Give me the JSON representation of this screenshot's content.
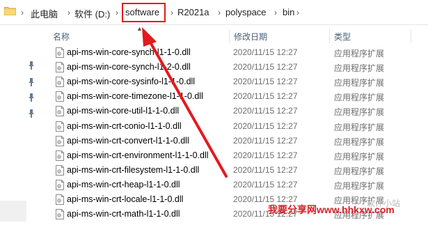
{
  "address_bar": {
    "segments": [
      "此电脑",
      "软件 (D:)",
      "software",
      "R2021a",
      "polyspace",
      "bin"
    ]
  },
  "columns": {
    "name": "名称",
    "date": "修改日期",
    "type": "类型"
  },
  "files": [
    {
      "name": "api-ms-win-core-synch-l1-1-0.dll",
      "date": "2020/11/15 12:27",
      "type": "应用程序扩展"
    },
    {
      "name": "api-ms-win-core-synch-l1-2-0.dll",
      "date": "2020/11/15 12:27",
      "type": "应用程序扩展"
    },
    {
      "name": "api-ms-win-core-sysinfo-l1-1-0.dll",
      "date": "2020/11/15 12:27",
      "type": "应用程序扩展"
    },
    {
      "name": "api-ms-win-core-timezone-l1-1-0.dll",
      "date": "2020/11/15 12:27",
      "type": "应用程序扩展"
    },
    {
      "name": "api-ms-win-core-util-l1-1-0.dll",
      "date": "2020/11/15 12:27",
      "type": "应用程序扩展"
    },
    {
      "name": "api-ms-win-crt-conio-l1-1-0.dll",
      "date": "2020/11/15 12:27",
      "type": "应用程序扩展"
    },
    {
      "name": "api-ms-win-crt-convert-l1-1-0.dll",
      "date": "2020/11/15 12:27",
      "type": "应用程序扩展"
    },
    {
      "name": "api-ms-win-crt-environment-l1-1-0.dll",
      "date": "2020/11/15 12:27",
      "type": "应用程序扩展"
    },
    {
      "name": "api-ms-win-crt-filesystem-l1-1-0.dll",
      "date": "2020/11/15 12:27",
      "type": "应用程序扩展"
    },
    {
      "name": "api-ms-win-crt-heap-l1-1-0.dll",
      "date": "2020/11/15 12:27",
      "type": "应用程序扩展"
    },
    {
      "name": "api-ms-win-crt-locale-l1-1-0.dll",
      "date": "2020/11/15 12:27",
      "type": "应用程序扩展"
    },
    {
      "name": "api-ms-win-crt-math-l1-1-0.dll",
      "date": "2020/11/15 12:27",
      "type": "应用程序扩展"
    }
  ],
  "watermark": {
    "site": "我要分享网www.hhkxw.com",
    "account": "软件小站"
  },
  "colors": {
    "highlight_red": "#e5191e",
    "header_text": "#4c607a",
    "meta_text": "#6d6d6d"
  }
}
